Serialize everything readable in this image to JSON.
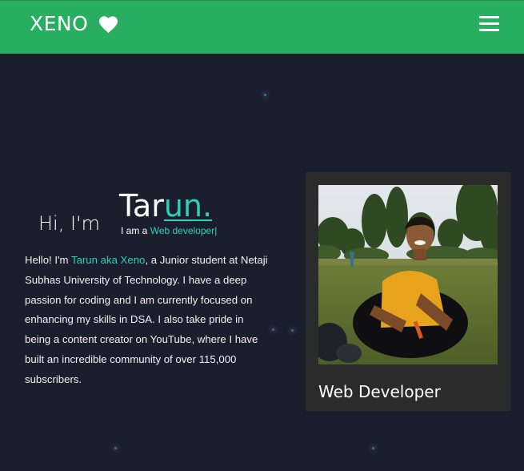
{
  "nav": {
    "brand": "XENO",
    "brand_icon": "heart-icon",
    "menu_icon": "hamburger-menu-icon",
    "background_color": "#27ae60"
  },
  "hero": {
    "greeting": "Hi, I'm",
    "name_part1": "Tar",
    "name_part2": "un.",
    "role_prefix": "I am a",
    "role_value": "Web developer",
    "role_cursor": "|",
    "accent_color": "#2ed0b6"
  },
  "bio": {
    "text1": "Hello! I'm",
    "highlight": "Tarun aka Xeno",
    "text2": ", a Junior student at Netaji Subhas University of Technology. I have a deep passion for coding and I am currently focused on enhancing my skills in DSA. I also take pride in being a content creator on YouTube, where I have built an incredible community of over 115,000 subscribers."
  },
  "profile_card": {
    "caption": "Web Developer"
  }
}
